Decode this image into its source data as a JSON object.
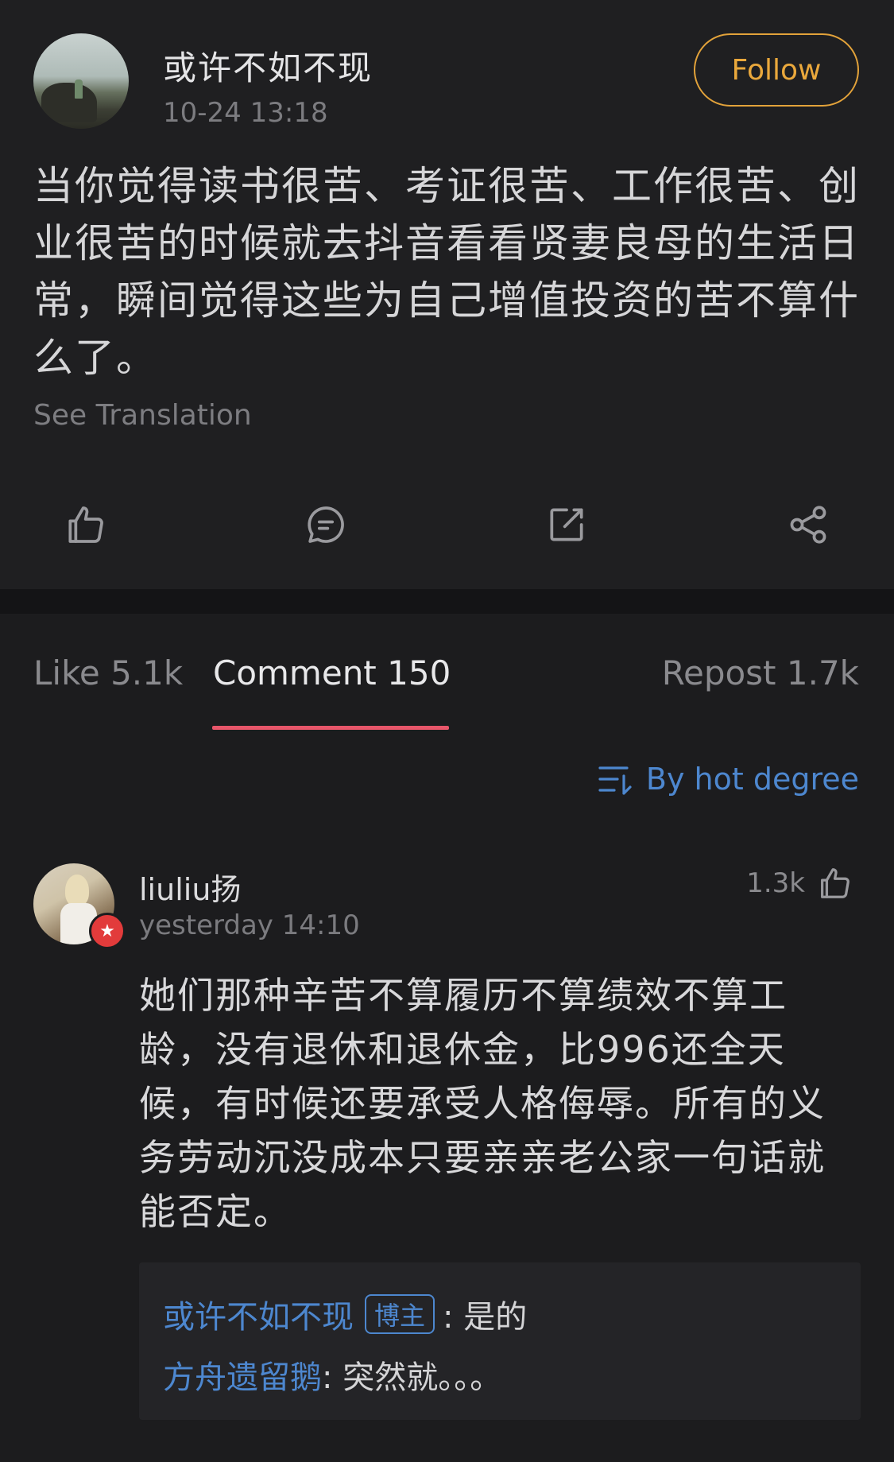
{
  "post": {
    "username": "或许不如不现",
    "time": "10-24 13:18",
    "follow_label": "Follow",
    "text": "当你觉得读书很苦、考证很苦、工作很苦、创业很苦的时候就去抖音看看贤妻良母的生活日常，瞬间觉得这些为自己增值投资的苦不算什么了。",
    "see_translation": "See Translation",
    "actions": [
      "like-icon",
      "comment-icon",
      "repost-icon",
      "share-icon"
    ]
  },
  "tabs": [
    {
      "label": "Like 5.1k"
    },
    {
      "label": "Comment 150"
    },
    {
      "label": "Repost 1.7k"
    }
  ],
  "sort": {
    "label": "By hot degree",
    "icon": "sort-icon"
  },
  "comment": {
    "username": "liuliu扬",
    "time": "yesterday 14:10",
    "likes": "1.3k",
    "text": "她们那种辛苦不算履历不算绩效不算工龄，没有退休和退休金，比996还全天候，有时候还要承受人格侮辱。所有的义务劳动沉没成本只要亲亲老公家一句话就能否定。",
    "replies": [
      {
        "name": "或许不如不现",
        "tag": "博主",
        "text": ": 是的"
      },
      {
        "name": "方舟遗留鹅",
        "tag": "",
        "text": ": 突然就。。。"
      }
    ]
  },
  "colors": {
    "accent_follow": "#eaa83c",
    "link_blue": "#4d87cf",
    "tab_underline": "#e8566a",
    "background": "#1c1c1e"
  }
}
